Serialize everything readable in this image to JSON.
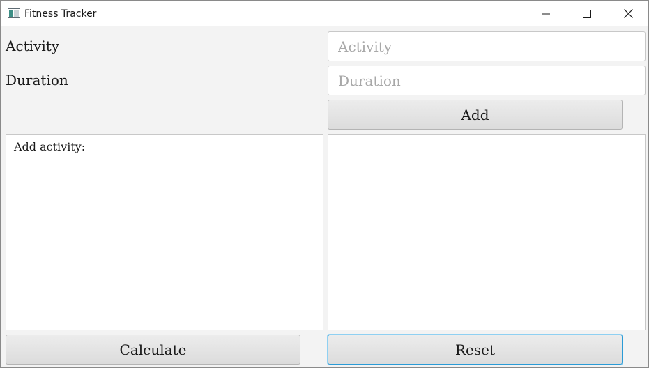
{
  "window": {
    "title": "Fitness Tracker",
    "icon": "app-window-icon",
    "controls": [
      "minimize-icon",
      "maximize-icon",
      "close-icon"
    ]
  },
  "form": {
    "activity_label": "Activity",
    "activity_placeholder": "Activity",
    "activity_value": "",
    "duration_label": "Duration",
    "duration_placeholder": "Duration",
    "duration_value": "",
    "add_button": "Add"
  },
  "left_panel": {
    "text": "Add activity:"
  },
  "right_panel": {
    "text": ""
  },
  "buttons": {
    "calculate": "Calculate",
    "reset": "Reset"
  },
  "colors": {
    "focus_border": "#2a9bd6",
    "window_bg": "#f3f3f3"
  }
}
